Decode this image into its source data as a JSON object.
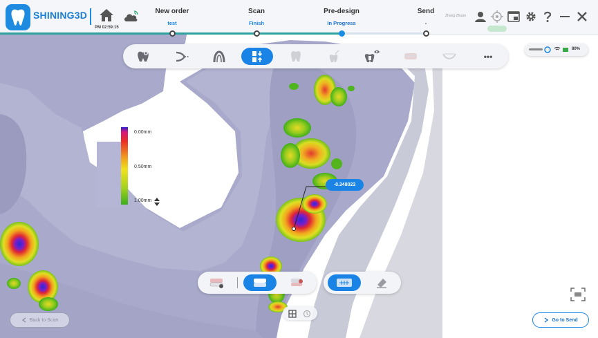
{
  "brand": {
    "name": "SHINING3D",
    "accent": "#1a84e6"
  },
  "header": {
    "clock": "PM 02:59:15",
    "user_name": "Zhang Zhuan",
    "status_pill": "",
    "steps": [
      {
        "title": "New order",
        "status": "test",
        "status_color": "#1a84e6"
      },
      {
        "title": "Scan",
        "status": "Finish",
        "status_color": "#1a84e6"
      },
      {
        "title": "Pre-design",
        "status": "In Progress",
        "status_color": "#1a6fd0"
      },
      {
        "title": "Send",
        "status": "-",
        "status_color": "#333333"
      }
    ]
  },
  "top_toolbar": {
    "tools": [
      "tooth-marker-icon",
      "jaw-alignment-icon",
      "arch-icon",
      "occlusion-check-icon",
      "tooth-faded-icon",
      "tooth-tool-faded-icon",
      "tooth-visibility-icon",
      "jaw-faded-icon",
      "jaw-outline-faded-icon",
      "more-icon"
    ],
    "active_index": 3,
    "more_label": "•••"
  },
  "device_status": {
    "battery": "80%"
  },
  "legend": {
    "top": "0.00mm",
    "mid": "0.50mm",
    "bottom": "1.00mm"
  },
  "measurement": {
    "value": "-0.348023"
  },
  "bottom_toolbar": {
    "group1": [
      "upper-jaw-view-icon",
      "both-jaws-view-icon",
      "lower-jaw-view-icon"
    ],
    "group1_active": 1,
    "group2": [
      "distance-map-icon",
      "eraser-icon"
    ],
    "group2_active": 0
  },
  "buttons": {
    "back": "Back to Scan",
    "send": "Go to Send"
  }
}
